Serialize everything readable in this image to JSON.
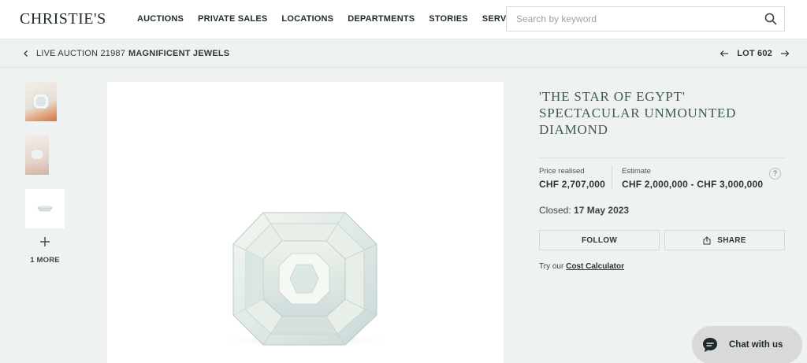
{
  "header": {
    "logo": "CHRISTIE'S",
    "nav": [
      "AUCTIONS",
      "PRIVATE SALES",
      "LOCATIONS",
      "DEPARTMENTS",
      "STORIES",
      "SERVICES"
    ],
    "search_placeholder": "Search by keyword"
  },
  "breadcrumb": {
    "sale_label": "LIVE AUCTION 21987",
    "sale_title": "MAGNIFICENT JEWELS",
    "lot_label": "LOT 602"
  },
  "gallery": {
    "more_label": "1 MORE"
  },
  "lot": {
    "title": "'THE STAR OF EGYPT' SPECTACULAR UNMOUNTED DIAMOND",
    "price_label": "Price realised",
    "price_value": "CHF 2,707,000",
    "estimate_label": "Estimate",
    "estimate_value": "CHF 2,000,000 - CHF 3,000,000",
    "help_symbol": "?",
    "closed_label": "Closed:",
    "closed_date": "17 May 2023",
    "follow_label": "FOLLOW",
    "share_label": "SHARE",
    "calc_prefix": "Try our",
    "calc_link": "Cost Calculator"
  },
  "chat": {
    "label": "Chat with us"
  },
  "colors": {
    "page_bg": "#eef3f1",
    "title_green": "#3f5a50",
    "chat_bg": "#d9d9d9"
  }
}
